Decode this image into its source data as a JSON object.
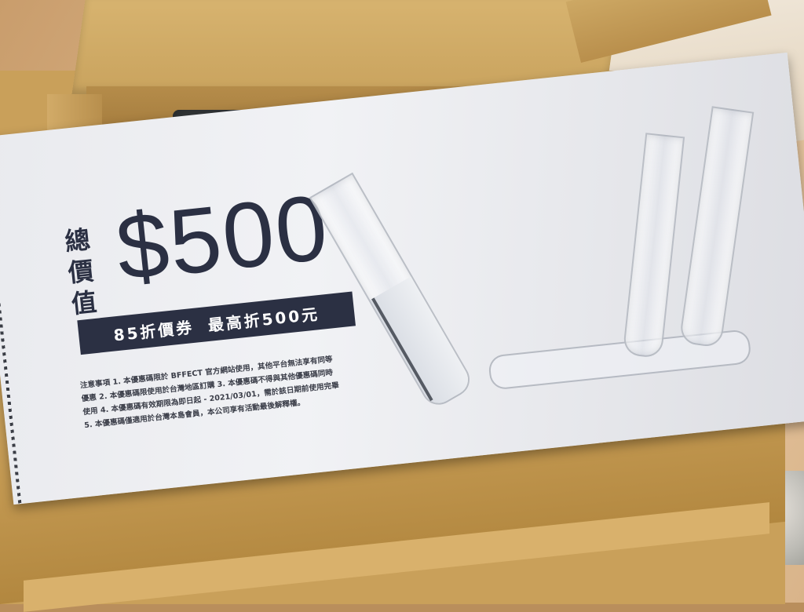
{
  "coupon": {
    "title_chars": [
      "總",
      "價",
      "值"
    ],
    "amount": "$500",
    "banner_left": "85折價券",
    "banner_right": "最高折500元",
    "notes": [
      "注意事項 1. 本優惠碼限於 BFFECT 官方網站使用，其他平台無法享有同等",
      "優惠 2. 本優惠碼限使用於台灣地區訂購 3. 本優惠碼不得與其他優惠碼同時",
      "使用 4. 本優惠碼有效期限為即日起 - 2021/03/01，需於該日期前使用完畢",
      "5. 本優惠碼僅適用於台灣本島會員，本公司享有活動最後解釋權。"
    ]
  },
  "colors": {
    "ink": "#2b3043",
    "paper": "#eeeff2",
    "cardboard": "#c9a05a"
  }
}
